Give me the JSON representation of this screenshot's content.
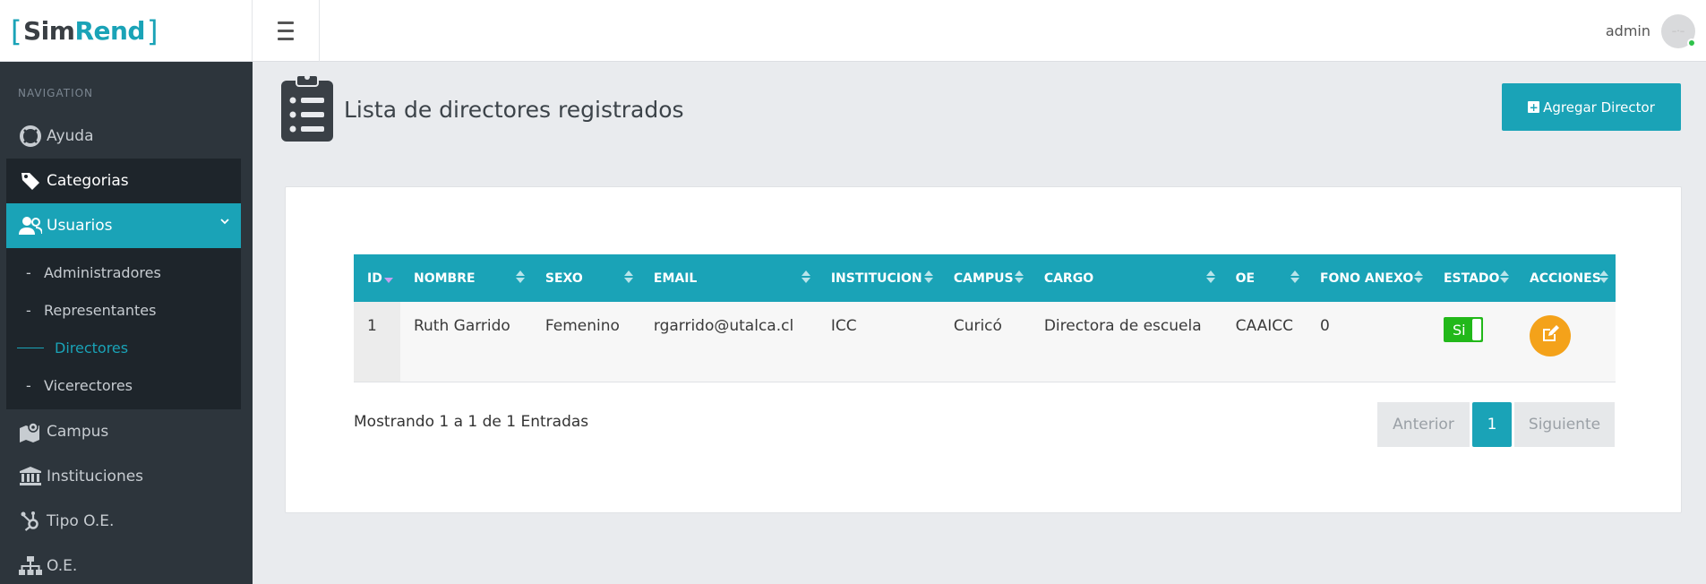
{
  "brand": {
    "bracket_open": "[",
    "sim": "Sim",
    "rend": "Rend",
    "bracket_close": "]"
  },
  "header": {
    "user_name": "admin",
    "avatar_placeholder": "–·–",
    "accent": "#1aa3b7"
  },
  "sidebar": {
    "section_label": "NAVIGATION",
    "items": [
      {
        "label": "Ayuda",
        "icon": "life-ring-icon"
      },
      {
        "label": "Categorias",
        "icon": "tag-icon"
      },
      {
        "label": "Usuarios",
        "icon": "users-icon"
      },
      {
        "label": "Campus",
        "icon": "map-icon"
      },
      {
        "label": "Instituciones",
        "icon": "institution-icon"
      },
      {
        "label": "Tipo O.E.",
        "icon": "hubspot-icon"
      },
      {
        "label": "O.E.",
        "icon": "sitemap-icon"
      }
    ],
    "submenu": [
      {
        "label": "Administradores"
      },
      {
        "label": "Representantes"
      },
      {
        "label": "Directores"
      },
      {
        "label": "Vicerectores"
      }
    ]
  },
  "page": {
    "title": "Lista de directores registrados",
    "add_button": "Agregar Director"
  },
  "table": {
    "columns": [
      "ID",
      "NOMBRE",
      "SEXO",
      "EMAIL",
      "INSTITUCION",
      "CAMPUS",
      "CARGO",
      "OE",
      "FONO ANEXO",
      "ESTADO",
      "ACCIONES"
    ],
    "rows": [
      {
        "id": "1",
        "nombre": "Ruth Garrido",
        "sexo": "Femenino",
        "email": "rgarrido@utalca.cl",
        "institucion": "ICC",
        "campus": "Curicó",
        "cargo": "Directora de escuela",
        "oe": "CAAICC",
        "fono": "0",
        "estado": "Si"
      }
    ]
  },
  "footer": {
    "info": "Mostrando 1 a 1 de 1 Entradas",
    "prev": "Anterior",
    "page": "1",
    "next": "Siguiente"
  }
}
